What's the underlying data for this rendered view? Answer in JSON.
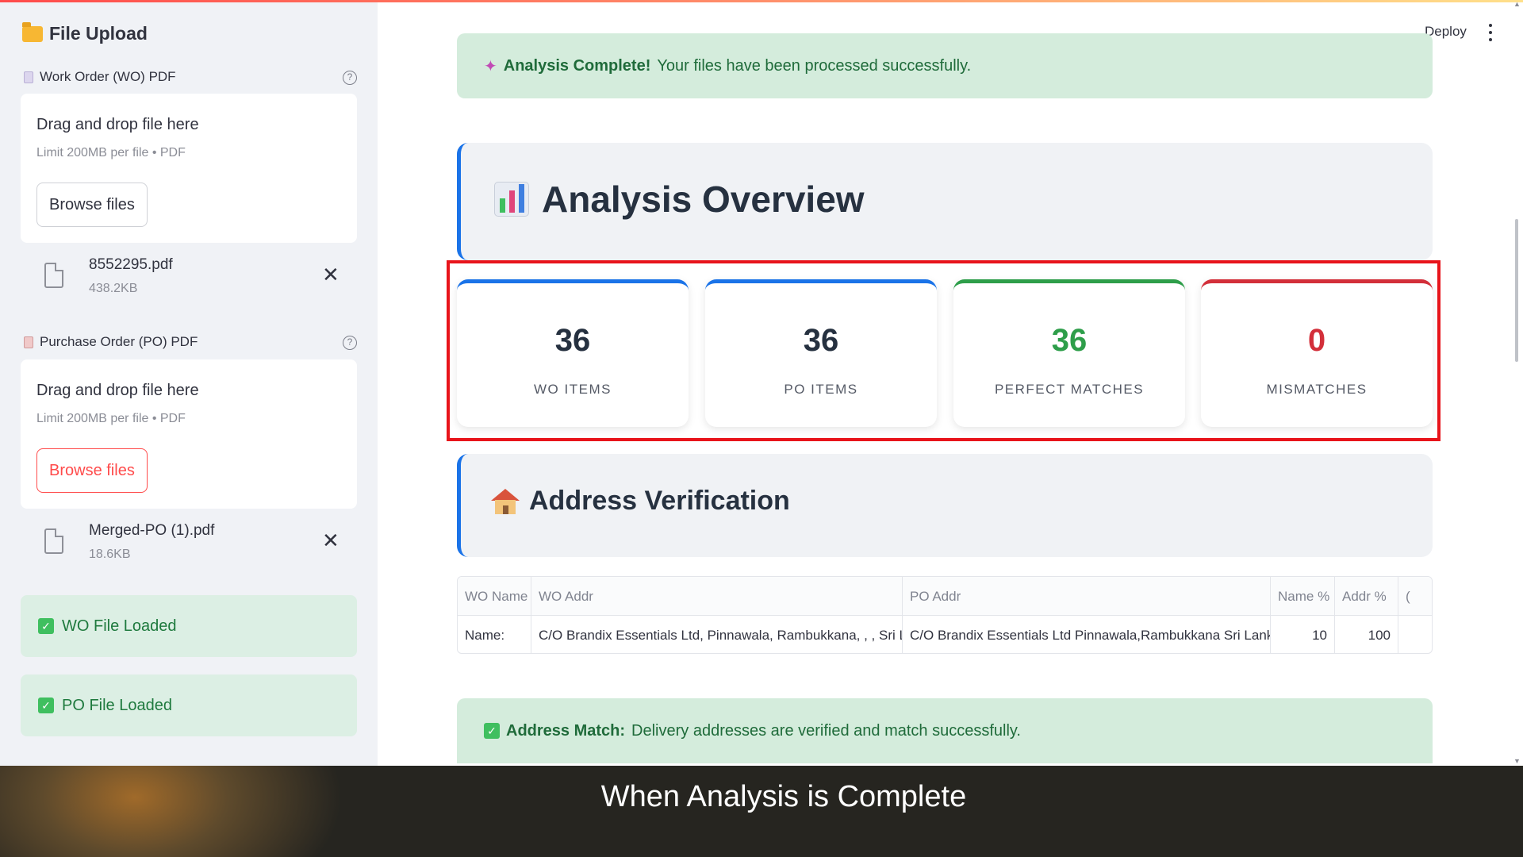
{
  "sidebar": {
    "title": "File Upload",
    "wo": {
      "label": "Work Order (WO) PDF",
      "dropzone_title": "Drag and drop file here",
      "dropzone_limit": "Limit 200MB per file • PDF",
      "browse_label": "Browse files",
      "file_name": "8552295.pdf",
      "file_size": "438.2KB"
    },
    "po": {
      "label": "Purchase Order (PO) PDF",
      "dropzone_title": "Drag and drop file here",
      "dropzone_limit": "Limit 200MB per file • PDF",
      "browse_label": "Browse files",
      "file_name": "Merged-PO (1).pdf",
      "file_size": "18.6KB"
    },
    "status": {
      "wo_loaded": "WO File Loaded",
      "po_loaded": "PO File Loaded"
    }
  },
  "header": {
    "deploy_label": "Deploy"
  },
  "main": {
    "complete_alert": {
      "strong": "Analysis Complete!",
      "text": "Your files have been processed successfully."
    },
    "overview_title": "Analysis Overview",
    "metrics": [
      {
        "value": "36",
        "label": "WO ITEMS",
        "color": "#263140",
        "accent": "#1a73e8"
      },
      {
        "value": "36",
        "label": "PO ITEMS",
        "color": "#263140",
        "accent": "#1a73e8"
      },
      {
        "value": "36",
        "label": "PERFECT MATCHES",
        "color": "#2e9e4a",
        "accent": "#2e9e4a"
      },
      {
        "value": "0",
        "label": "MISMATCHES",
        "color": "#d32f3a",
        "accent": "#d32f3a"
      }
    ],
    "address_title": "Address Verification",
    "table": {
      "headers": [
        "WO Name",
        "WO Addr",
        "PO Addr",
        "Name %",
        "Addr %",
        "("
      ],
      "row": [
        "Name:",
        "C/O Brandix Essentials Ltd, Pinnawala, Rambukkana, , , Sri Lanka",
        "C/O Brandix Essentials Ltd Pinnawala,Rambukkana Sri Lanka",
        "10",
        "100",
        ""
      ]
    },
    "address_alert": {
      "strong": "Address Match:",
      "text": "Delivery addresses are verified and match successfully."
    }
  },
  "caption": "When Analysis is Complete",
  "colors": {
    "accent_blue": "#1a73e8",
    "success_green": "#2e9e4a",
    "error_red": "#d32f3a",
    "highlight_red": "#e8141b"
  }
}
